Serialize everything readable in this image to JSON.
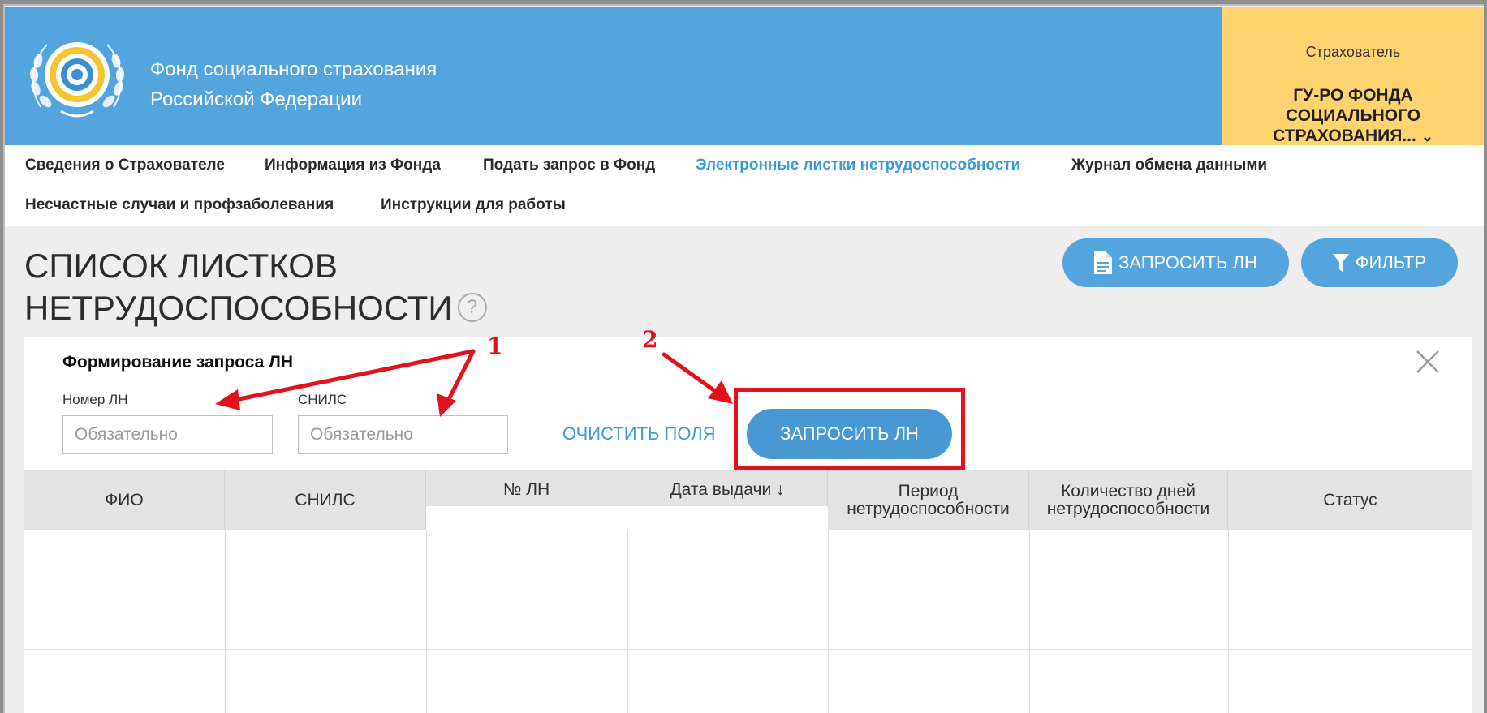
{
  "header": {
    "org_line1": "Фонд социального страхования",
    "org_line2": "Российской Федерации",
    "insurer_caption": "Страхователь",
    "insurer_name": "ГУ-РО ФОНДА СОЦИАЛЬНОГО СТРАХОВАНИЯ...",
    "brand_color": "#54a5de",
    "insurer_bg_color": "#ffd370"
  },
  "nav": {
    "items": [
      {
        "label": "Сведения о Страхователе"
      },
      {
        "label": "Информация из Фонда"
      },
      {
        "label": "Подать запрос в Фонд"
      },
      {
        "label": "Электронные листки нетрудоспособности",
        "active": true
      },
      {
        "label": "Журнал обмена данными"
      },
      {
        "label": "Несчастные случаи и профзаболевания"
      },
      {
        "label": "Инструкции для работы"
      }
    ]
  },
  "page": {
    "title_line1": "СПИСОК ЛИСТКОВ",
    "title_line2": "НЕТРУДОСПОСОБНОСТИ",
    "help_symbol": "?",
    "request_button": "ЗАПРОСИТЬ ЛН",
    "filter_button": "ФИЛЬТР"
  },
  "request_panel": {
    "title": "Формирование запроса ЛН",
    "ln_label": "Номер ЛН",
    "ln_placeholder": "Обязательно",
    "snils_label": "СНИЛС",
    "snils_placeholder": "Обязательно",
    "clear_link": "ОЧИСТИТЬ ПОЛЯ",
    "submit_button": "ЗАПРОСИТЬ ЛН"
  },
  "table": {
    "columns": [
      "ФИО",
      "СНИЛС",
      "№ ЛН",
      "Дата выдачи ↓",
      "Период нетрудоспособности",
      "Количество дней нетрудоспособности",
      "Статус"
    ],
    "column_lines": [
      [
        "ФИО"
      ],
      [
        "СНИЛС"
      ],
      [
        "№ ЛН"
      ],
      [
        "Дата выдачи ↓"
      ],
      [
        "Период",
        "нетрудоспособности"
      ],
      [
        "Количество дней",
        "нетрудоспособности"
      ],
      [
        "Статус"
      ]
    ]
  },
  "annotations": {
    "marker_1": "1",
    "marker_2": "2",
    "color": "#e3111b"
  }
}
